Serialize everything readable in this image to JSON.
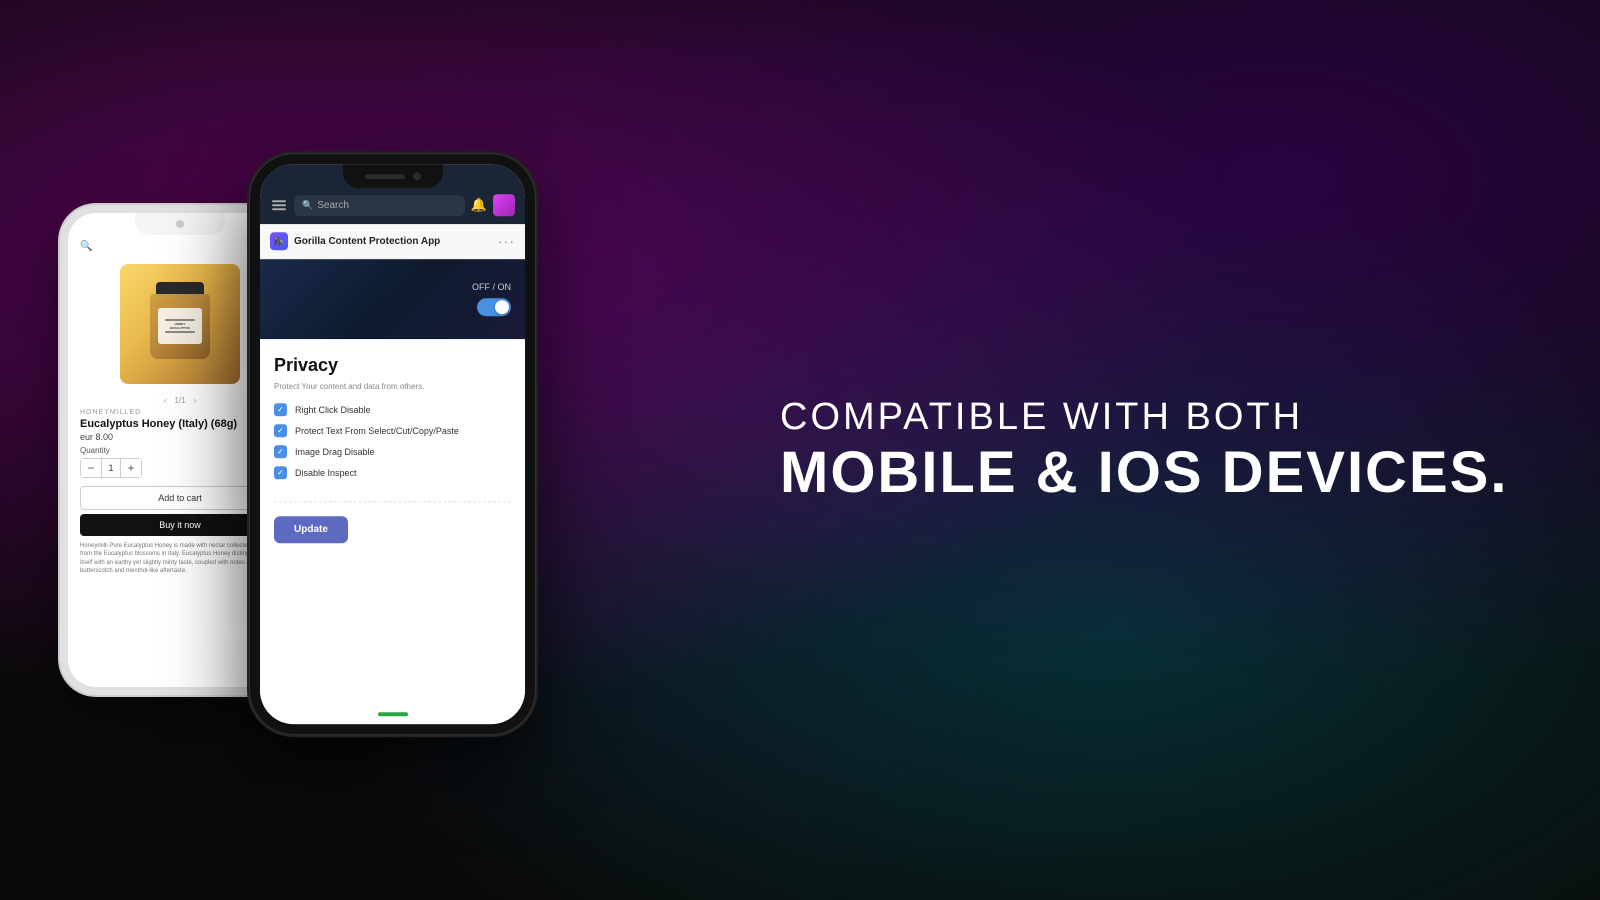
{
  "background": {
    "colors": [
      "#1a0020",
      "#0a0a20",
      "#001a20"
    ]
  },
  "phone_white": {
    "brand": "HONEYMILLED",
    "product_title": "Eucalyptus Honey (Italy) (68g)",
    "price": "eur 8.00",
    "quantity_label": "Quantity",
    "quantity_value": "1",
    "btn_cart": "Add to cart",
    "btn_buy": "Buy it now",
    "description": "Honeymilli Pure Eucalyptus Honey is made with nectar collected by bees from the Eucalyptus blossoms in Italy. Eucalyptus Honey distinguishes itself with an earthy yet slightly minty taste, coupled with notes of butterscotch and menthol-like aftertaste."
  },
  "phone_black": {
    "search_placeholder": "Search",
    "app_title": "Gorilla Content Protection App",
    "toggle_label": "OFF / ON",
    "toggle_state": true,
    "section_title": "Privacy",
    "section_subtitle": "Protect Your content and data from others.",
    "checkboxes": [
      {
        "label": "Right Click Disable",
        "checked": true
      },
      {
        "label": "Protect Text From Select/Cut/Copy/Paste",
        "checked": true
      },
      {
        "label": "Image Drag Disable",
        "checked": true
      },
      {
        "label": "Disable Inspect",
        "checked": true
      }
    ],
    "update_button": "Update"
  },
  "headline": {
    "line1": "COMPATIBLE WITH BOTH",
    "line2": "MOBILE & IOS DEVICES."
  }
}
